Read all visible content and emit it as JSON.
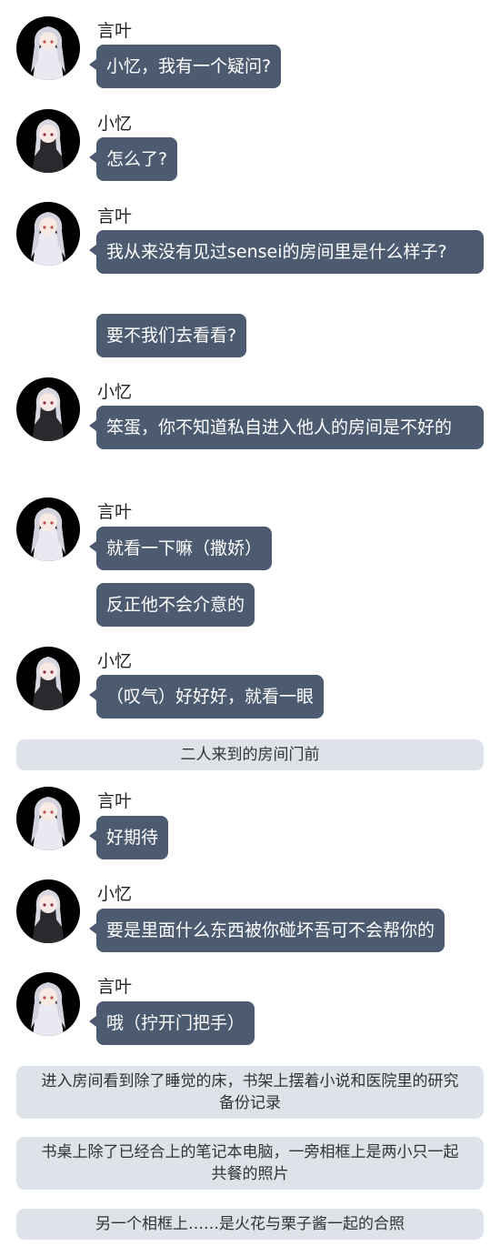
{
  "speakers": {
    "yanye": "言叶",
    "xiaoyi": "小忆"
  },
  "messages": {
    "m1": "小忆，我有一个疑问?",
    "m2": "怎么了?",
    "m3": "我从来没有见过sensei的房间里是什么样子?",
    "m4": "要不我们去看看?",
    "m5": "笨蛋，你不知道私自进入他人的房间是不好的",
    "m6": "就看一下嘛（撒娇）",
    "m7": "反正他不会介意的",
    "m8": "（叹气）好好好，就看一眼",
    "m9": "好期待",
    "m10": "要是里面什么东西被你碰坏吾可不会帮你的",
    "m11": "哦（拧开门把手）"
  },
  "narration": {
    "n1": "二人来到的房间门前",
    "n2": "进入房间看到除了睡觉的床，书架上摆着小说和医院里的研究备份记录",
    "n3": "书桌上除了已经合上的笔记本电脑，一旁相框上是两小只一起共餐的照片",
    "n4": "另一个相框上……是火花与栗子酱一起的合照"
  },
  "colors": {
    "bubble": "#4c5b70",
    "bubble_text": "#ffffff",
    "narration_bg": "#dde3e8",
    "avatar_bg": "#000000"
  },
  "icons": {
    "yanye_avatar": "white-haired-girl-white-dress-avatar",
    "xiaoyi_avatar": "white-haired-girl-black-dress-avatar"
  }
}
